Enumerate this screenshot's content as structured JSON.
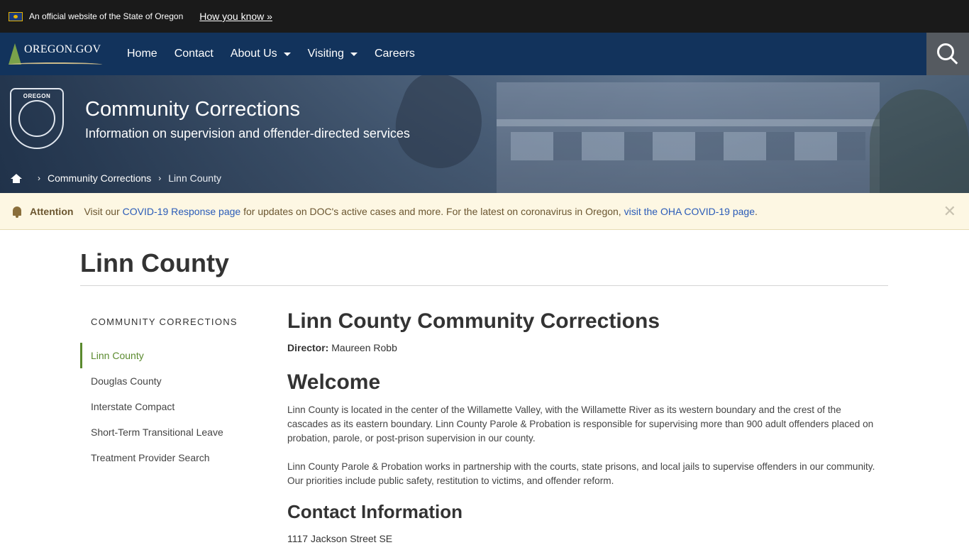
{
  "banner": {
    "official_text": "An official website of the State of Oregon",
    "how_link": "How you know »"
  },
  "nav": {
    "logo_text": "OREGON.GOV",
    "items": [
      {
        "label": "Home"
      },
      {
        "label": "Contact"
      },
      {
        "label": "About Us"
      },
      {
        "label": "Visiting"
      },
      {
        "label": "Careers"
      }
    ]
  },
  "hero": {
    "seal_label": "OREGON",
    "title": "Community Corrections",
    "subtitle": "Information on supervision and offender-directed services",
    "breadcrumb": {
      "link": "Community Corrections",
      "current": "Linn County"
    }
  },
  "alert": {
    "label": "Attention",
    "text_1": "Visit our ",
    "link_1": "COVID-19 Response page",
    "text_2": " for updates on DOC's active cases and more. For the latest on coronavirus in Oregon, ",
    "link_2": "visit the OHA COVID-19 page",
    "text_3": ".",
    "close": "✕"
  },
  "page": {
    "title": "Linn County"
  },
  "sidebar": {
    "heading": "COMMUNITY CORRECTIONS",
    "items": [
      {
        "label": "Linn County"
      },
      {
        "label": "Douglas County"
      },
      {
        "label": "Interstate Compact"
      },
      {
        "label": "Short-Term Transitional Leave"
      },
      {
        "label": "Treatment Provider Search"
      }
    ]
  },
  "main": {
    "heading": "Linn County Community Corrections",
    "director_label": "Director:",
    "director_name": " Maureen Robb",
    "welcome_heading": "Welcome",
    "para_1": "Linn County is located in the center of the Willamette Valley, with the Willamette River as its western boundary and the crest of the cascades as its eastern boundary. Linn County Parole & Probation is responsible for supervising more than 900 adult offenders placed on probation, parole, or post-prison supervision in our county.",
    "para_2": "Linn County Parole & Probation works in partnership with the courts, state prisons, and local jails to supervise offenders in our community. Our priorities include public safety, restitution to victims, and offender reform.",
    "contact_heading": "Contact Information",
    "address_line": "1117 Jackson Street SE"
  }
}
